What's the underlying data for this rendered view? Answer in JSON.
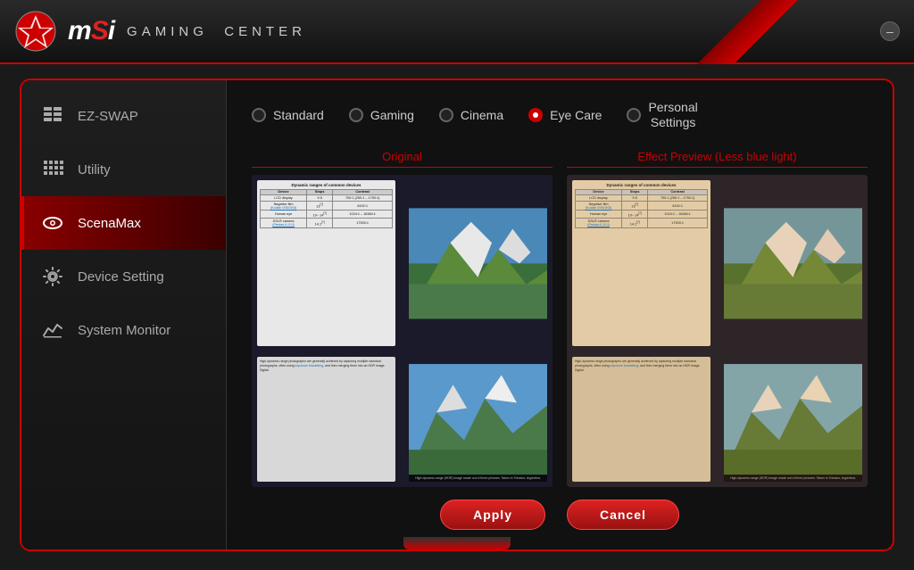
{
  "app": {
    "title": "MSI GAMING CENTER",
    "msi_label": "msi",
    "gaming_label": "GAMING",
    "center_label": "CENTER"
  },
  "header": {
    "minimize_label": "–"
  },
  "sidebar": {
    "items": [
      {
        "id": "ez-swap",
        "label": "EZ-SWAP",
        "icon": "grid-icon",
        "active": false
      },
      {
        "id": "utility",
        "label": "Utility",
        "icon": "grid2-icon",
        "active": false
      },
      {
        "id": "scenamax",
        "label": "ScenaMax",
        "icon": "eye-icon",
        "active": true
      },
      {
        "id": "device-setting",
        "label": "Device Setting",
        "icon": "gear-icon",
        "active": false
      },
      {
        "id": "system-monitor",
        "label": "System Monitor",
        "icon": "chart-icon",
        "active": false
      }
    ]
  },
  "modes": [
    {
      "id": "standard",
      "label": "Standard",
      "active": false
    },
    {
      "id": "gaming",
      "label": "Gaming",
      "active": false
    },
    {
      "id": "cinema",
      "label": "Cinema",
      "active": false
    },
    {
      "id": "eye-care",
      "label": "Eye Care",
      "active": true
    },
    {
      "id": "personal",
      "label": "Personal\nSettings",
      "active": false
    }
  ],
  "previews": {
    "original": {
      "title": "Original",
      "table_title": "Dynamic ranges of common devices",
      "table_headers": [
        "Device",
        "Stops",
        "Contrast"
      ],
      "table_rows": [
        [
          "LCD display",
          "9.5",
          "700:1 (250:1 – 1750:1)"
        ],
        [
          "Negative film\n(Kodak VISION3)",
          "13[?]",
          "8192:1"
        ],
        [
          "Human eye",
          "10–\n14[?]",
          "1024:1 –\n16384:1"
        ],
        [
          "DSLR camera\n(Pentax K-5 II)",
          "14.1[?]",
          "17500:1"
        ]
      ],
      "text_content": "High-dynamic-range photographs are generally achieved by capturing multiple standard photographs, often using exposure bracketing, and then merging them into an HDR image. Digital",
      "caption": "High-dynamic-range (HDR) image made out of three pictures. Taken in Trinador, Argentina."
    },
    "effect": {
      "title": "Effect Preview (Less blue light)",
      "table_title": "Dynamic ranges of common devices",
      "table_headers": [
        "Device",
        "Stops",
        "Contrast"
      ],
      "table_rows": [
        [
          "LCD display",
          "9.5",
          "700:1 (250:1 – 1750:1)"
        ],
        [
          "Negative film\n(Kodak VISION3)",
          "13[?]",
          "8192:1"
        ],
        [
          "Human eye",
          "10–\n14[?]",
          "1024:1 –\n16384:1"
        ],
        [
          "DSLR camera\n(Pentax K-5 II)",
          "14.1[?]",
          "17500:1"
        ]
      ],
      "text_content": "High-dynamic-range photographs are generally achieved by capturing multiple standard photographs, often using exposure bracketing, and then merging them into an HDR image. Digital",
      "caption": "High-dynamic-range (HDR) image made out of three pictures. Taken in Trinador, Argentina."
    }
  },
  "buttons": {
    "apply": "Apply",
    "cancel": "Cancel"
  }
}
